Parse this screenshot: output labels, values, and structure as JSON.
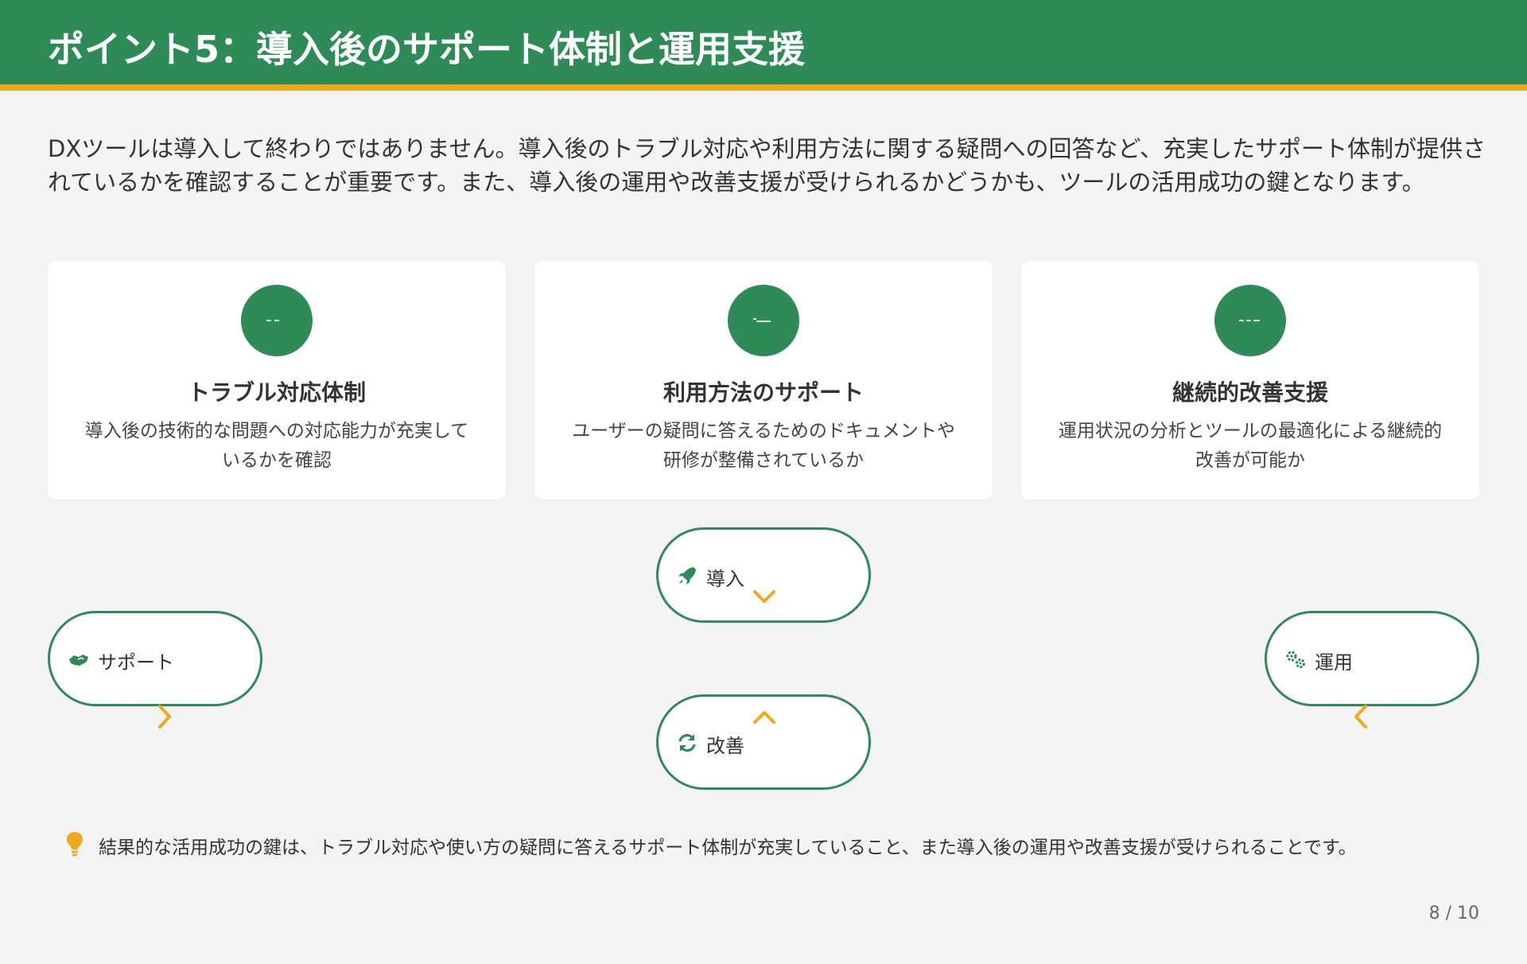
{
  "header": {
    "title": "ポイント5：導入後のサポート体制と運用支援"
  },
  "intro": {
    "text": "DXツールは導入して終わりではありません。導入後のトラブル対応や利用方法に関する疑問への回答など、充実したサポート体制が提供されているかを確認することが重要です。また、導入後の運用や改善支援が受けられるかどうかも、ツールの活用成功の鍵となります。"
  },
  "cards": [
    {
      "title": "トラブル対応体制",
      "description": "導入後の技術的な問題への対応能力が充実しているかを確認",
      "icon": "tools-icon"
    },
    {
      "title": "利用方法のサポート",
      "description": "ユーザーの疑問に答えるためのドキュメントや研修が整備されているか",
      "icon": "support-icon"
    },
    {
      "title": "継続的改善支援",
      "description": "運用状況の分析とツールの最適化による継続的改善が可能か",
      "icon": "chart-icon"
    }
  ],
  "cycle": {
    "intro": {
      "label": "導入",
      "icon": "rocket-icon"
    },
    "operation": {
      "label": "運用",
      "icon": "gears-icon"
    },
    "improvement": {
      "label": "改善",
      "icon": "sync-icon"
    },
    "support": {
      "label": "サポート",
      "icon": "handshake-icon"
    }
  },
  "note": {
    "icon": "lightbulb-icon",
    "text": "結果的な活用成功の鍵は、トラブル対応や使い方の疑問に答えるサポート体制が充実していること、また導入後の運用や改善支援が受けられることです。"
  },
  "footer": {
    "page": "8 / 10"
  },
  "colors": {
    "primary": "#2e8b57",
    "accent": "#f0a81c",
    "background": "#f4f4f4"
  }
}
